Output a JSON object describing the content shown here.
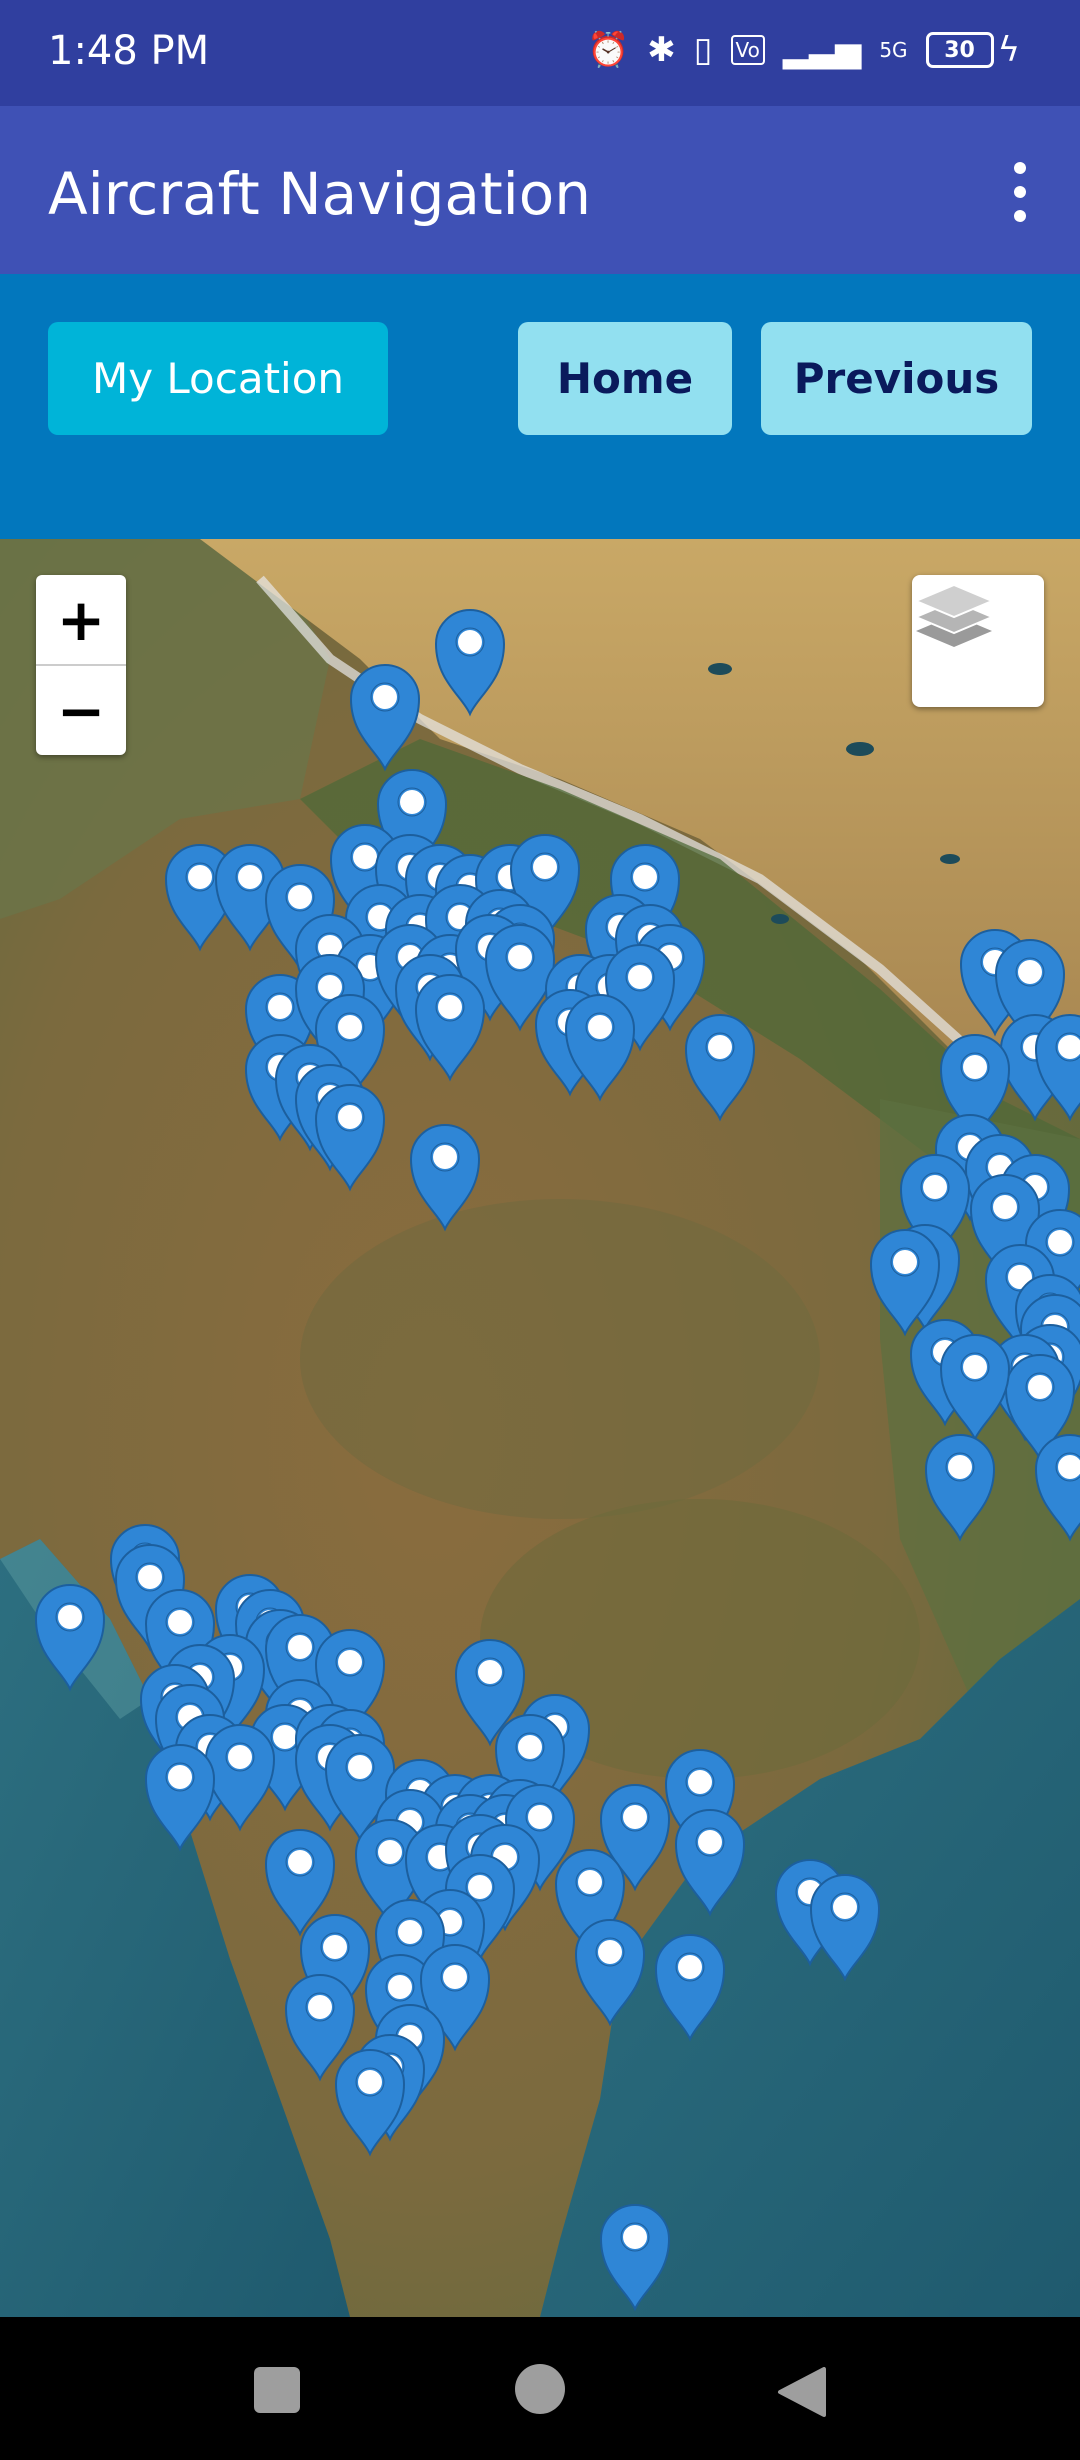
{
  "status_bar": {
    "time": "1:48 PM",
    "battery": "30",
    "icons": [
      "alarm-icon",
      "bluetooth-icon",
      "vibrate-icon",
      "volte-icon",
      "signal-icon",
      "5g-icon",
      "battery-icon",
      "charging-icon"
    ]
  },
  "app_bar": {
    "title": "Aircraft Navigation",
    "menu_icon": "overflow-menu-icon"
  },
  "toolbar": {
    "my_location": "My Location",
    "home": "Home",
    "previous": "Previous"
  },
  "map": {
    "zoom_in": "+",
    "zoom_out": "−",
    "layers_icon": "layers-icon",
    "marker_icon": "map-pin-icon"
  },
  "nav_bar": {
    "icons": [
      "recent-apps-icon",
      "home-icon",
      "back-icon"
    ]
  }
}
